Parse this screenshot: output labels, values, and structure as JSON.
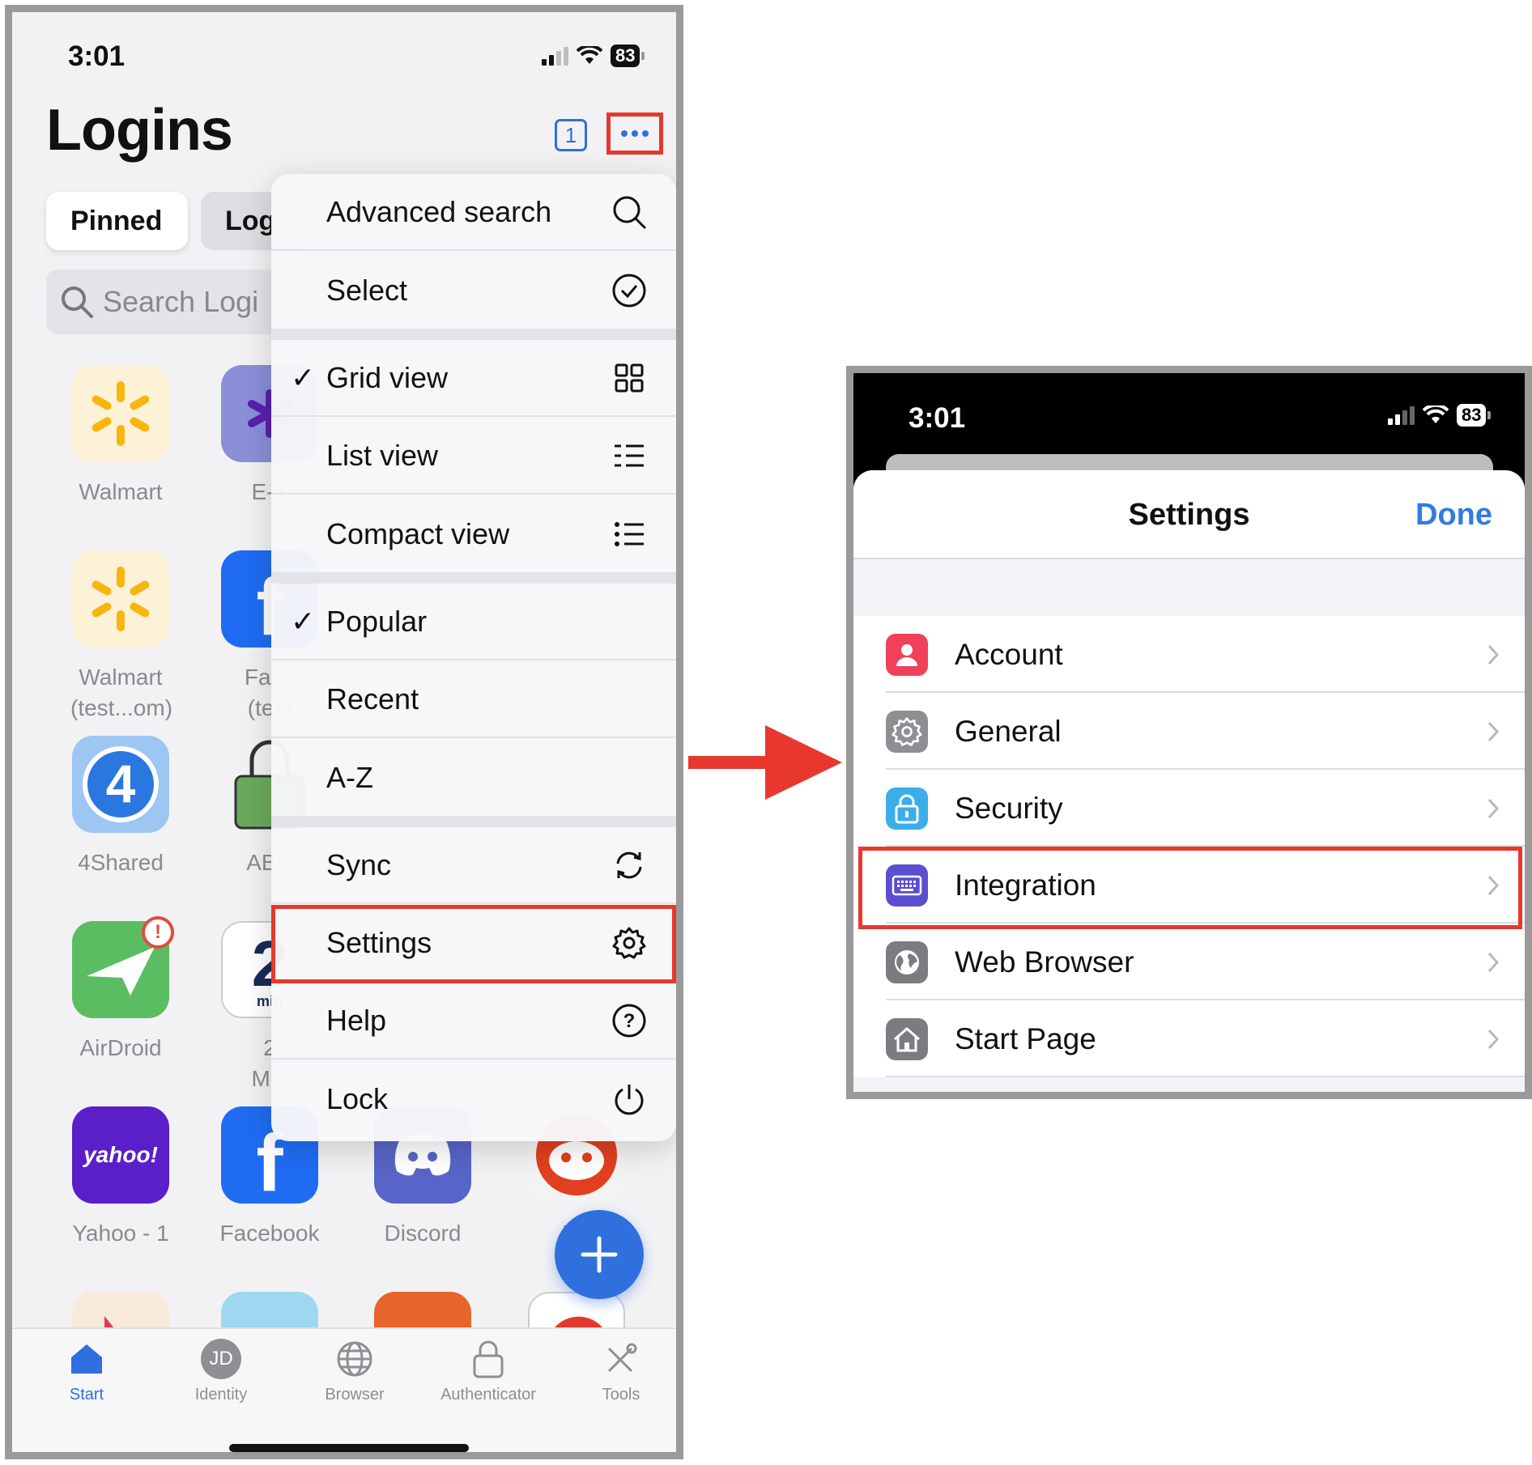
{
  "left": {
    "status": {
      "time": "3:01",
      "battery": "83"
    },
    "title": "Logins",
    "counter": "1",
    "tabs": [
      {
        "label": "Pinned"
      },
      {
        "label": "Log"
      }
    ],
    "search_placeholder": "Search Logi",
    "apps": [
      {
        "label": "Walmart"
      },
      {
        "label": "E-T"
      },
      {
        "label": "Walmart"
      },
      {
        "label": "(test...om)"
      },
      {
        "label": "Face"
      },
      {
        "label": "(test"
      },
      {
        "label": "4Shared"
      },
      {
        "label": "ABC"
      },
      {
        "label": "AirDroid"
      },
      {
        "label": "2"
      },
      {
        "label": "Min"
      },
      {
        "label": "Yahoo - 1"
      },
      {
        "label": "Facebook"
      },
      {
        "label": "Discord"
      },
      {
        "label": "Re"
      }
    ],
    "menu": {
      "items": [
        {
          "label": "Advanced search"
        },
        {
          "label": "Select"
        },
        {
          "label": "Grid view",
          "checked": true
        },
        {
          "label": "List view"
        },
        {
          "label": "Compact view"
        },
        {
          "label": "Popular",
          "checked": true
        },
        {
          "label": "Recent"
        },
        {
          "label": "A-Z"
        },
        {
          "label": "Sync"
        },
        {
          "label": "Settings"
        },
        {
          "label": "Help"
        },
        {
          "label": "Lock"
        }
      ],
      "check_glyph": "✓"
    },
    "yahoo_logo_text": "yahoo!",
    "twomin_text": "min",
    "identity_initials": "JD",
    "tabbar": [
      {
        "label": "Start"
      },
      {
        "label": "Identity"
      },
      {
        "label": "Browser"
      },
      {
        "label": "Authenticator"
      },
      {
        "label": "Tools"
      }
    ]
  },
  "right": {
    "status": {
      "time": "3:01",
      "battery": "83"
    },
    "title": "Settings",
    "done": "Done",
    "rows": [
      {
        "label": "Account",
        "color": "#f0405a"
      },
      {
        "label": "General",
        "color": "#8e8e93"
      },
      {
        "label": "Security",
        "color": "#3aaee8"
      },
      {
        "label": "Integration",
        "color": "#5b4fcf"
      },
      {
        "label": "Web Browser",
        "color": "#7c7c80"
      },
      {
        "label": "Start Page",
        "color": "#7c7c80"
      }
    ]
  },
  "colors": {
    "accent": "#2f6fde",
    "highlight": "#e8382e"
  }
}
